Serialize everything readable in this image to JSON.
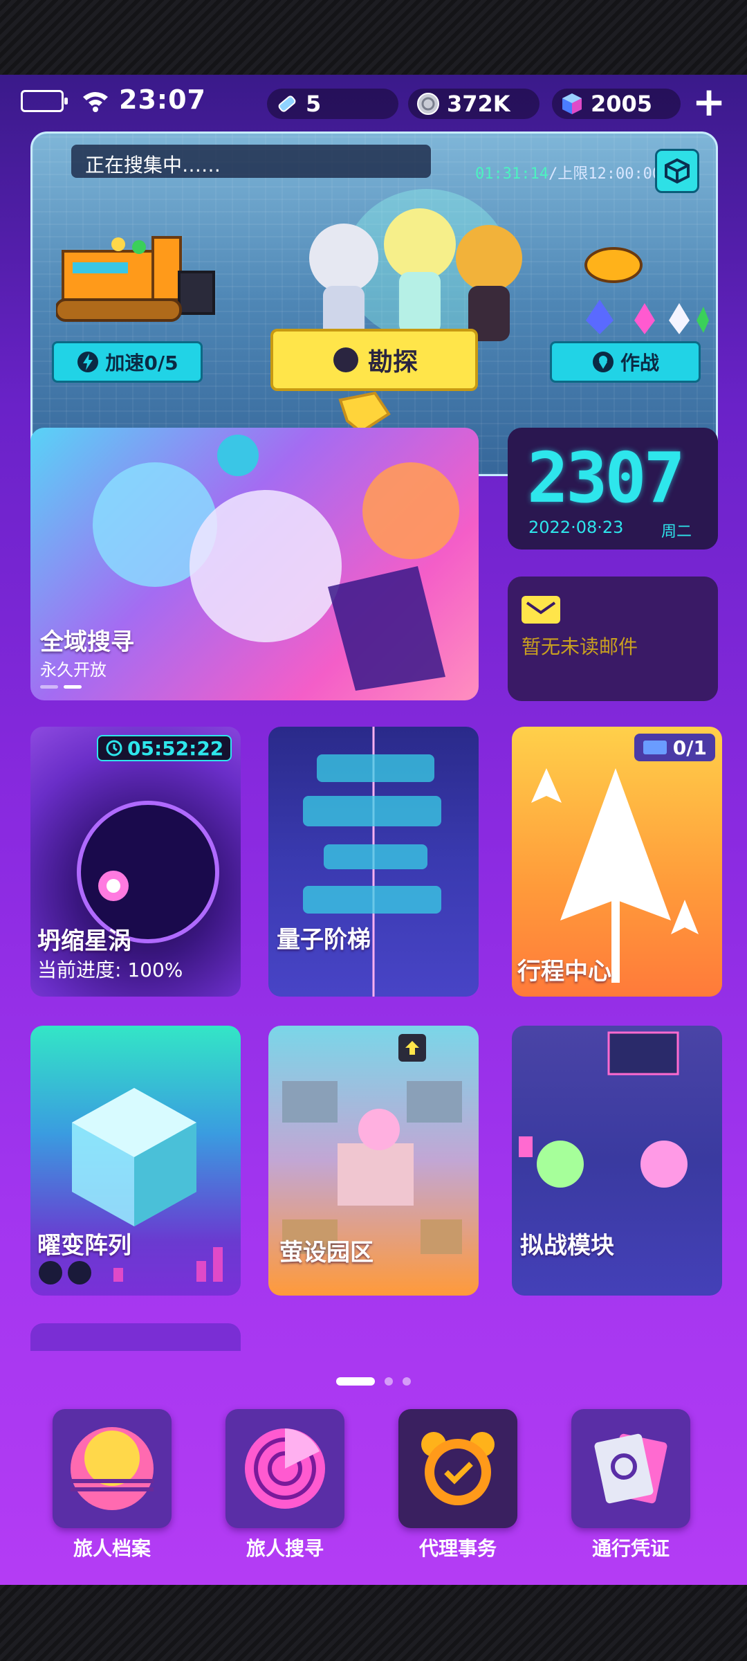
{
  "status": {
    "time": "23:07",
    "stamina": "5",
    "coins": "372K",
    "gems": "2005"
  },
  "banner": {
    "collect_label": "正在搜集中……",
    "timer_current": "01:31:14",
    "timer_limit": "/上限12:00:00",
    "speed_label": "加速0/5",
    "explore_label": "勘探",
    "battle_label": "作战"
  },
  "quanyu_card": {
    "title": "全域搜寻",
    "subtitle": "永久开放"
  },
  "clock_card": {
    "time": "2307",
    "date": "2022·08·23",
    "weekday": "周二"
  },
  "mail_card": {
    "text": "暂无未读邮件"
  },
  "cards": {
    "xingwo": {
      "title": "坍缩星涡",
      "progress": "当前进度:  100%",
      "timer": "05:52:22"
    },
    "liangzi": {
      "title": "量子阶梯"
    },
    "xingcheng": {
      "title": "行程中心",
      "count": "0/1"
    },
    "yaobian": {
      "title": "曜变阵列"
    },
    "mengshe": {
      "title": "萤设园区"
    },
    "nizhan": {
      "title": "拟战模块"
    }
  },
  "pager": {
    "pages": 3,
    "current": 1
  },
  "nav": [
    {
      "label": "旅人档案"
    },
    {
      "label": "旅人搜寻"
    },
    {
      "label": "代理事务"
    },
    {
      "label": "通行凭证"
    }
  ],
  "colors": {
    "accent_cyan": "#2ee6ec",
    "accent_yellow": "#ffe54a",
    "background": "#8a2ae0"
  }
}
